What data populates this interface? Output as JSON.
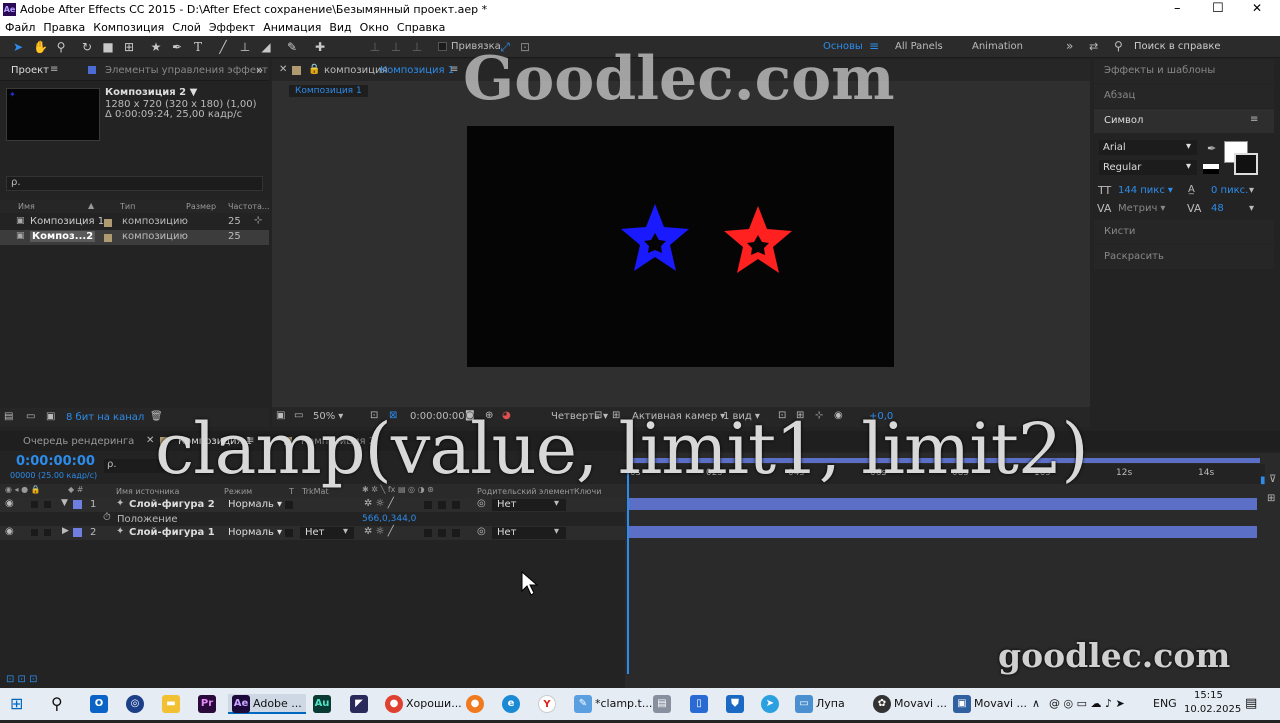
{
  "title_bar": {
    "title": "Adobe After Effects CC 2015 - D:\\After Efect сохранение\\Безымянный проект.aep *",
    "minimize": "–",
    "maximize": "☐",
    "close": "✕"
  },
  "menu": [
    "Файл",
    "Правка",
    "Композиция",
    "Слой",
    "Эффект",
    "Анимация",
    "Вид",
    "Окно",
    "Справка"
  ],
  "toolbar": {
    "snap_label": "Привязка",
    "workspaces": [
      "Основы",
      "All Panels",
      "Animation"
    ],
    "search_placeholder": "Поиск в справке"
  },
  "project_panel": {
    "tab_project": "Проект",
    "tab_effects": "Элементы управления эффект",
    "comp_name": "Композиция 2 ▼",
    "comp_info1": "1280 x 720  (320 x 180) (1,00)",
    "comp_info2": "Δ 0:00:09:24, 25,00 кадр/с",
    "search_icon_label": "ρ.",
    "columns": [
      "Имя",
      "Тип",
      "Размер",
      "Частота..."
    ],
    "items": [
      {
        "name": "Композиция 1",
        "type": "композицию",
        "fps": "25"
      },
      {
        "name": "Композ...2",
        "type": "композицию",
        "fps": "25"
      }
    ],
    "bit_depth": "8 бит на канал"
  },
  "comp_panel": {
    "tab_label": "композиция",
    "tab_name": "Композиция 1",
    "sub_tab": "Композиция 1",
    "zoom": "50%",
    "time": "0:00:00:00",
    "resolution": "Четверть",
    "camera": "Активная камер",
    "views": "1 вид",
    "exposure": "+0,0"
  },
  "right_panel": {
    "effects": "Эффекты и шаблоны",
    "paragraph": "Абзац",
    "character": "Символ",
    "font": "Arial",
    "style": "Regular",
    "size": "144 пикс",
    "leading": "0 пикс.",
    "kerning": "Метрич",
    "tracking": "48",
    "brushes": "Кисти",
    "paint": "Раскрасить"
  },
  "timeline": {
    "tabs": [
      "Очередь рендеринга",
      "Композиция 1",
      "Композиция 2"
    ],
    "timecode": "0:00:00:00",
    "frame_info": "00000 (25.00 кадр/с)",
    "col_headers": [
      "Имя источника",
      "Режим",
      "T",
      "TrkMat",
      "Родительский элемент",
      "Ключи"
    ],
    "ruler": [
      "0s",
      "02s",
      "04s",
      "06s",
      "08s",
      "10s",
      "12s",
      "14s"
    ],
    "layers": [
      {
        "num": "1",
        "name": "Слой-фигура 2",
        "mode": "Нормаль",
        "trkmat": "",
        "parent": "Нет",
        "color": "#6f7fe0"
      },
      {
        "num": "2",
        "name": "Слой-фигура 1",
        "mode": "Нормаль",
        "trkmat": "Нет",
        "parent": "Нет",
        "color": "#6f7fe0"
      }
    ],
    "property_name": "Положение",
    "property_value": "566,0,344,0"
  },
  "watermarks": {
    "top": "Goodlec.com",
    "code": "clamp(value, limit1, limit2)",
    "bottom": "goodlec.com"
  },
  "taskbar": {
    "items": [
      "Adobe ...",
      "Хороши...",
      "*clamp.t...",
      "Лупа",
      "Movavi ...",
      "Movavi ..."
    ],
    "lang": "ENG",
    "time": "15:15",
    "date": "10.02.2025"
  },
  "colors": {
    "accent": "#2d8ceb",
    "star_blue": "#1a1aff",
    "star_red": "#ff2020",
    "layer_bar": "#5b6fc7"
  }
}
